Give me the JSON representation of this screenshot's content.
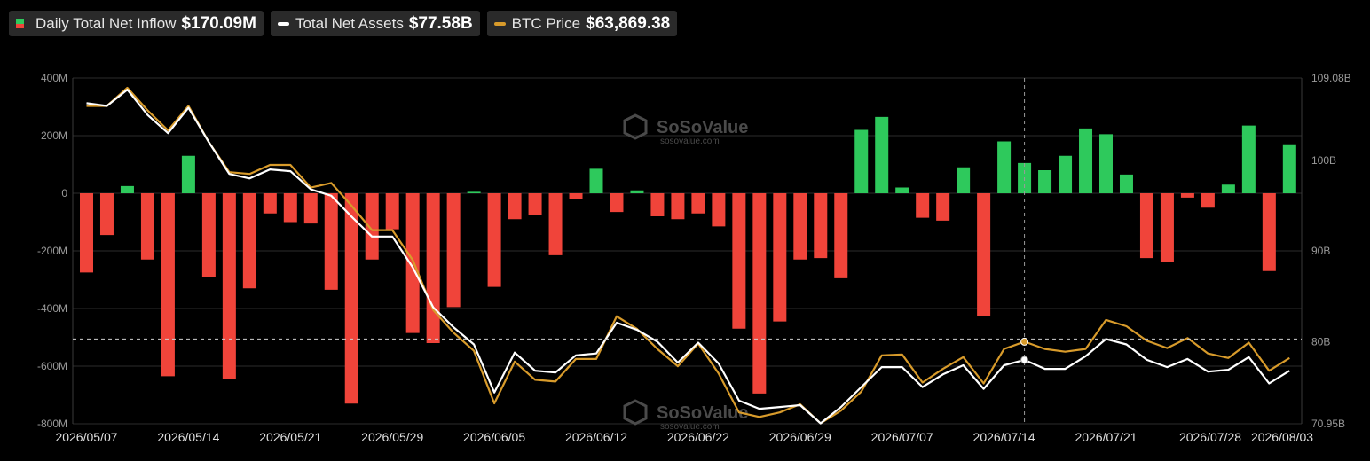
{
  "legend": {
    "inflow": {
      "label": "Daily Total Net Inflow",
      "value": "$170.09M"
    },
    "assets": {
      "label": "Total Net Assets",
      "value": "$77.58B"
    },
    "btc": {
      "label": "BTC Price",
      "value": "$63,869.38"
    }
  },
  "colors": {
    "positive": "#2ec95c",
    "negative": "#f0443a",
    "assets": "#ffffff",
    "btc": "#d89b2b",
    "grid": "#2c2c2c"
  },
  "watermark": {
    "brand": "SoSoValue",
    "site": "sosovalue.com"
  },
  "chart_data": {
    "type": "bar",
    "grid": true,
    "y_left": {
      "ticks": [
        "400M",
        "200M",
        "0",
        "-200M",
        "-400M",
        "-600M",
        "-800M"
      ],
      "range": [
        -800,
        400
      ]
    },
    "y_right": {
      "ticks": [
        "109.08B",
        "100B",
        "90B",
        "80B",
        "70.95B"
      ],
      "range": [
        70.95,
        109.08
      ]
    },
    "x_ticks": [
      "2026/05/07",
      "2026/05/14",
      "2026/05/21",
      "2026/05/29",
      "2026/06/05",
      "2026/06/12",
      "2026/06/22",
      "2026/06/29",
      "2026/07/07",
      "2026/07/14",
      "2026/07/21",
      "2026/07/28",
      "2026/08/03"
    ],
    "x_tick_index": [
      0,
      5,
      10,
      15,
      20,
      25,
      30,
      35,
      40,
      45,
      50,
      55,
      60
    ],
    "series": [
      {
        "name": "Daily Total Net Inflow",
        "unit": "M",
        "axis": "left",
        "values": [
          -275,
          -145,
          25,
          -230,
          -635,
          130,
          -290,
          -645,
          -330,
          -70,
          -100,
          -105,
          -335,
          -730,
          -230,
          -125,
          -485,
          -520,
          -395,
          5,
          -325,
          -90,
          -75,
          -215,
          -20,
          85,
          -65,
          10,
          -80,
          -90,
          -70,
          -115,
          -470,
          -695,
          -445,
          -230,
          -225,
          -295,
          220,
          265,
          20,
          -85,
          -95,
          90,
          -425,
          180,
          105,
          80,
          130,
          225,
          205,
          65,
          -225,
          -240,
          -15,
          -50,
          30,
          235,
          -270,
          170
        ]
      },
      {
        "name": "Total Net Assets",
        "unit": "B",
        "axis": "right",
        "values": [
          106.3,
          106.0,
          107.8,
          105.0,
          103.0,
          105.8,
          102.0,
          98.5,
          98.0,
          99.0,
          98.8,
          96.8,
          96.1,
          93.8,
          91.6,
          91.6,
          88.2,
          83.8,
          81.6,
          79.7,
          74.4,
          78.8,
          76.8,
          76.6,
          78.5,
          78.7,
          82.1,
          81.3,
          80.0,
          77.7,
          79.9,
          77.6,
          73.5,
          72.6,
          72.8,
          73.0,
          71.0,
          72.8,
          75.0,
          77.2,
          77.2,
          75.0,
          76.4,
          77.4,
          74.8,
          77.4,
          78.0,
          77.0,
          77.0,
          78.4,
          80.3,
          79.7,
          78.0,
          77.2,
          78.1,
          76.7,
          76.9,
          78.3,
          75.4,
          76.8
        ]
      },
      {
        "name": "BTC Price",
        "axis": "right",
        "values": [
          106.0,
          106.0,
          108.0,
          105.5,
          103.3,
          106.0,
          102.0,
          98.7,
          98.5,
          99.5,
          99.5,
          97.0,
          97.5,
          95.0,
          92.3,
          92.3,
          89.0,
          83.5,
          81.0,
          79.0,
          73.2,
          77.8,
          75.8,
          75.6,
          78.1,
          78.1,
          82.8,
          81.4,
          79.2,
          77.3,
          79.8,
          76.5,
          72.2,
          71.7,
          72.2,
          73.1,
          71.0,
          72.4,
          74.5,
          78.5,
          78.6,
          75.5,
          77.0,
          78.3,
          75.4,
          79.2,
          80.0,
          79.2,
          78.9,
          79.2,
          82.4,
          81.7,
          80.1,
          79.3,
          80.4,
          78.7,
          78.2,
          79.9,
          76.8,
          78.2
        ]
      }
    ]
  }
}
